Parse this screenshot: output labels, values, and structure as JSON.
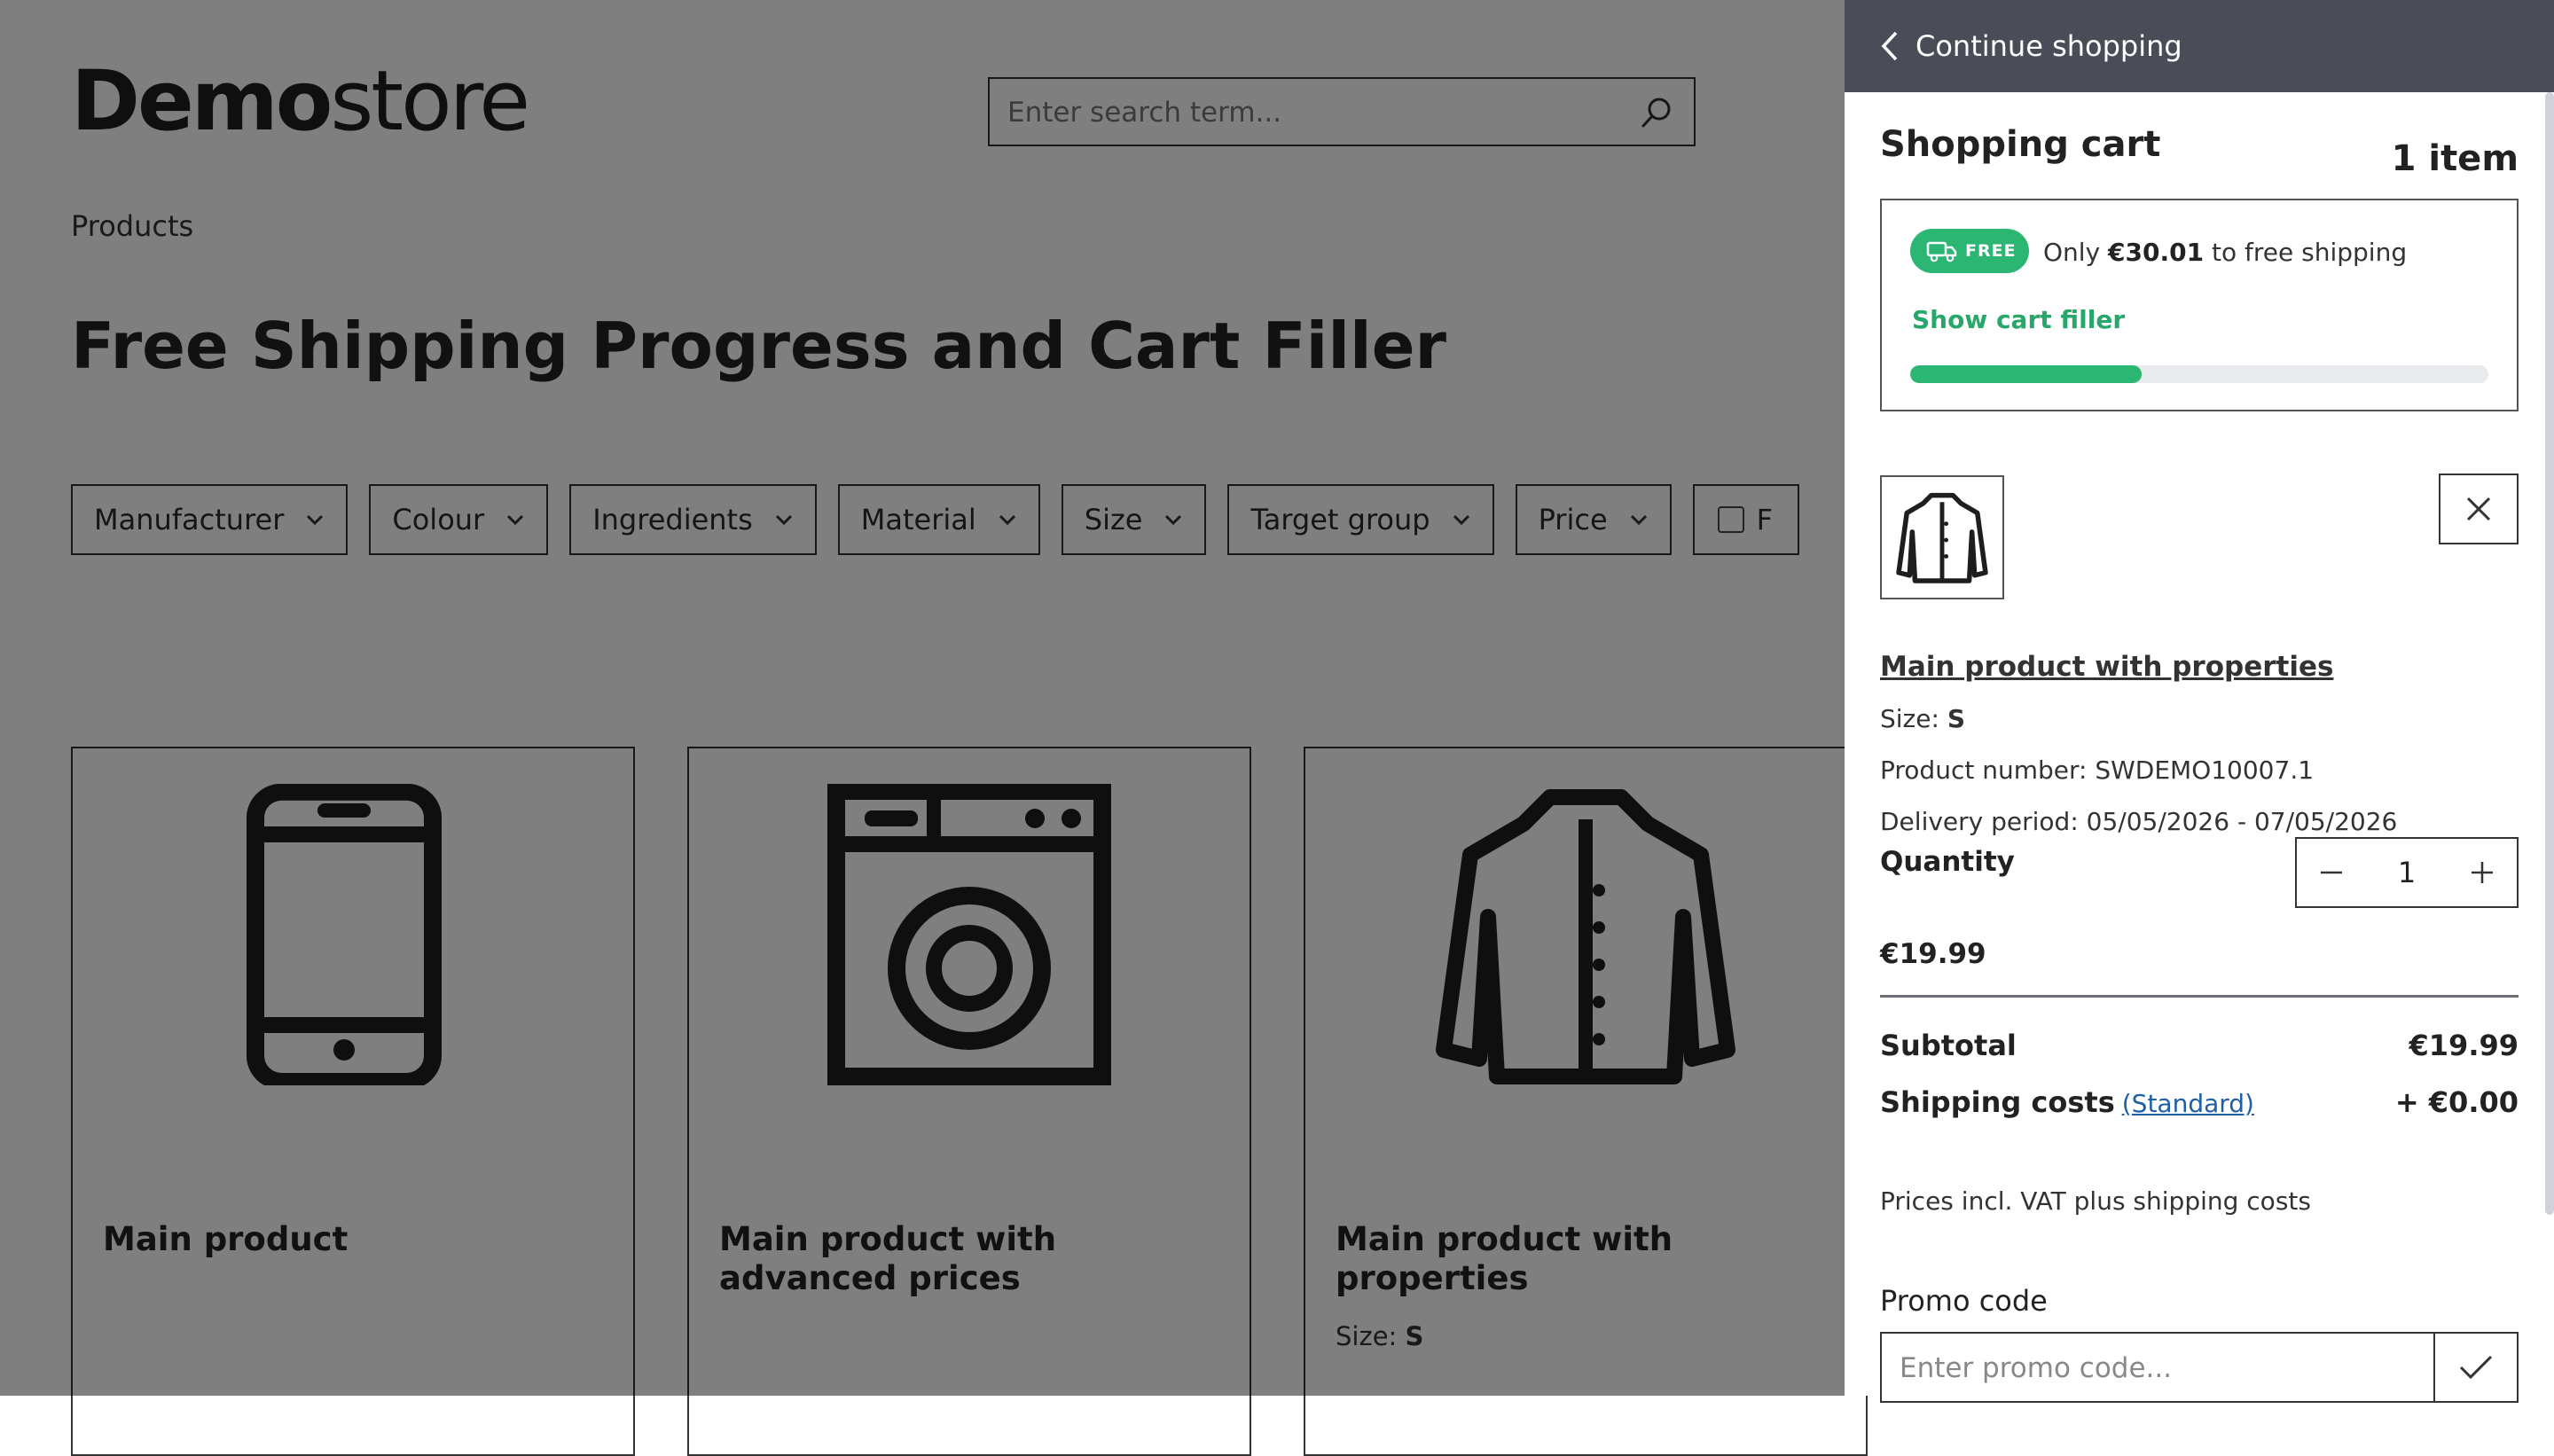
{
  "store": {
    "logo_bold": "Demo",
    "logo_light": "store",
    "search_placeholder": "Enter search term...",
    "breadcrumb": "Products",
    "page_title": "Free Shipping Progress and Cart Filler",
    "filters": [
      "Manufacturer",
      "Colour",
      "Ingredients",
      "Material",
      "Size",
      "Target group",
      "Price"
    ],
    "filter_checkbox_label": "F",
    "products": [
      {
        "name": "Main product",
        "icon": "smartphone-icon"
      },
      {
        "name": "Main product with advanced prices",
        "icon": "washing-machine-icon"
      },
      {
        "name": "Main product with properties",
        "icon": "jacket-icon",
        "prop_label": "Size:",
        "prop_value": "S"
      }
    ]
  },
  "cart": {
    "back_label": "Continue shopping",
    "title": "Shopping cart",
    "item_count": "1 item",
    "shipping": {
      "badge": "FREE",
      "text_prefix": "Only",
      "amount": "€30.01",
      "text_suffix": "to free shipping",
      "filler_link": "Show cart filler",
      "progress_fraction": 0.4,
      "color": "#2bb673"
    },
    "item": {
      "name": "Main product with properties",
      "size_label": "Size:",
      "size_value": "S",
      "product_number": "Product number: SWDEMO10007.1",
      "delivery": "Delivery period: 05/05/2026 - 07/05/2026",
      "quantity_label": "Quantity",
      "quantity": "1",
      "price": "€19.99"
    },
    "summary": {
      "subtotal_label": "Subtotal",
      "subtotal": "€19.99",
      "shipping_label": "Shipping costs",
      "shipping_method": "(Standard)",
      "shipping_cost": "+ €0.00"
    },
    "vat_note": "Prices incl. VAT plus shipping costs",
    "promo_label": "Promo code",
    "promo_placeholder": "Enter promo code..."
  }
}
